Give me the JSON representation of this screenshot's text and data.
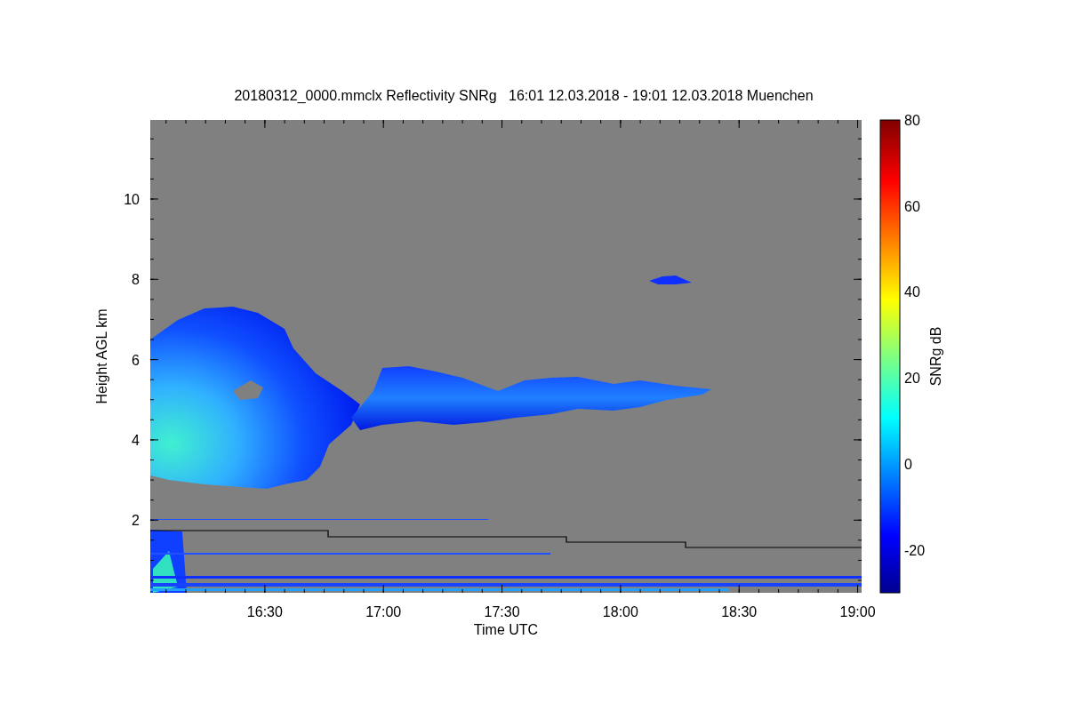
{
  "title": "20180312_0000.mmclx Reflectivity SNRg   16:01 12.03.2018 - 19:01 12.03.2018 Muenchen",
  "plot": {
    "xlabel": "Time UTC",
    "ylabel": "Height AGL km",
    "xticks": [
      "16:30",
      "17:00",
      "17:30",
      "18:00",
      "18:30",
      "19:00"
    ],
    "yticks": [
      "10",
      "8",
      "6",
      "4",
      "2"
    ]
  },
  "colorbar": {
    "label": "SNRg dB",
    "ticks": [
      "80",
      "60",
      "40",
      "20",
      "0",
      "-20"
    ]
  }
}
